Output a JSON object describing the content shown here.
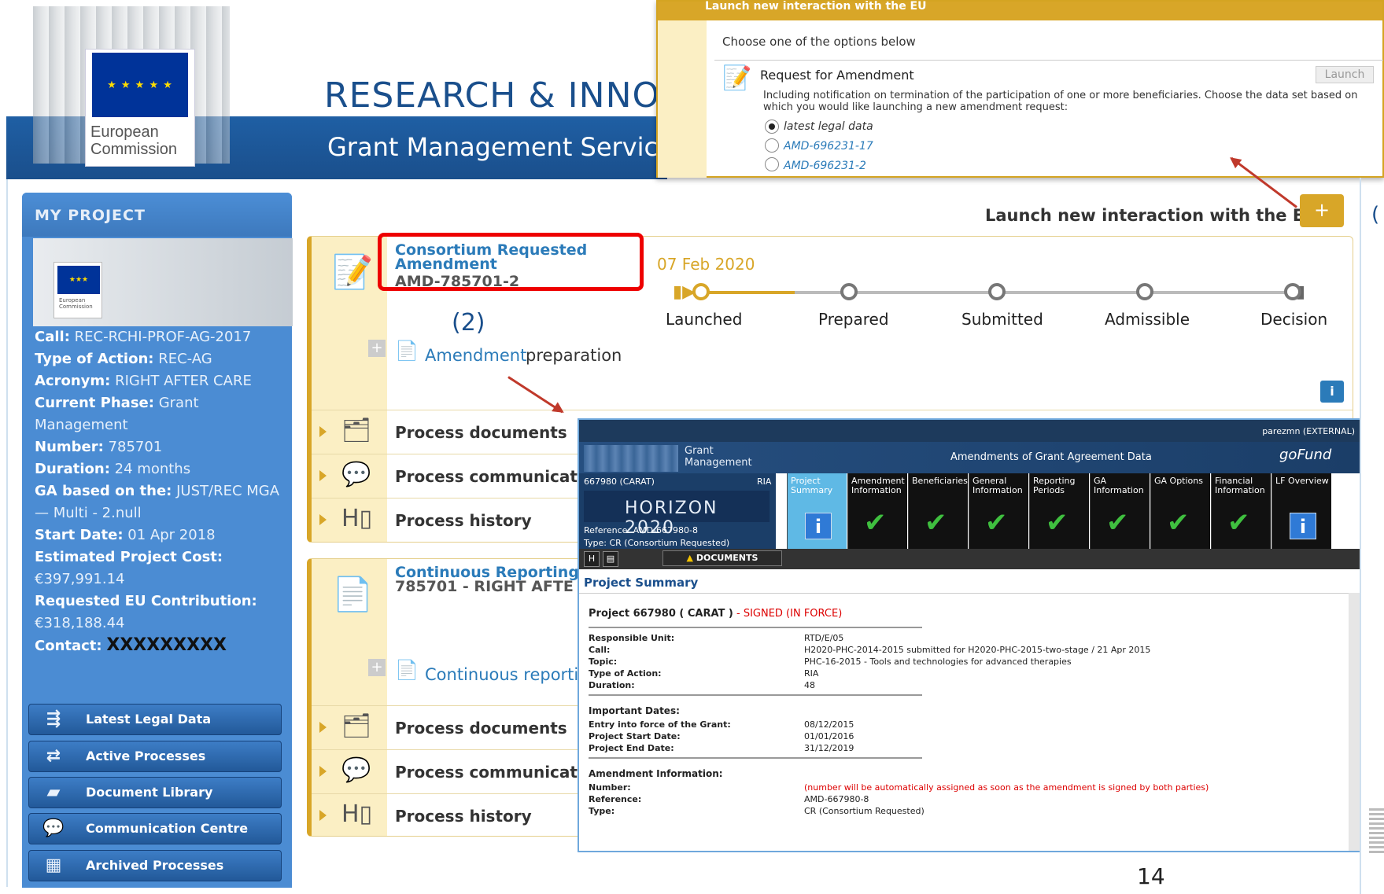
{
  "header": {
    "logo_stars": "★ ★ ★ ★ ★",
    "logo_name": "European Commission",
    "title_line1": "RESEARCH & INNOV",
    "title_line2": "Grant Management Service"
  },
  "popup": {
    "bar_title": "Launch new interaction with the EU",
    "hint": "Choose one of the options below",
    "option_title": "Request for Amendment",
    "launch_label": "Launch",
    "description": "Including notification on termination of the participation of one or more beneficiaries. Choose the data set based on which you would like launching a new amendment request:",
    "radios": [
      {
        "label": "latest legal data",
        "checked": true
      },
      {
        "label": "AMD-696231-17",
        "checked": false
      },
      {
        "label": "AMD-696231-2",
        "checked": false
      }
    ]
  },
  "sidebar": {
    "title": "MY PROJECT",
    "mini_logo": "European Commission",
    "info": [
      {
        "k": "Call:",
        "v": "REC-RCHI-PROF-AG-2017"
      },
      {
        "k": "Type of Action:",
        "v": "REC-AG"
      },
      {
        "k": "Acronym:",
        "v": "RIGHT AFTER CARE"
      },
      {
        "k": "Current Phase:",
        "v": "Grant Management"
      },
      {
        "k": "Number:",
        "v": "785701"
      },
      {
        "k": "Duration:",
        "v": "24 months"
      },
      {
        "k": "GA based on the:",
        "v": "JUST/REC MGA — Multi - 2.null"
      },
      {
        "k": "Start Date:",
        "v": "01 Apr 2018"
      },
      {
        "k": "Estimated Project Cost:",
        "v": "€397,991.14"
      },
      {
        "k": "Requested EU Contribution:",
        "v": "€318,188.44"
      },
      {
        "k": "Contact:",
        "v": "XXXXXXXXX"
      }
    ],
    "buttons": [
      {
        "label": "Latest Legal Data",
        "icon": "data-icon"
      },
      {
        "label": "Active Processes",
        "icon": "arrows-icon"
      },
      {
        "label": "Document Library",
        "icon": "folder-icon"
      },
      {
        "label": "Communication Centre",
        "icon": "chat-icon"
      },
      {
        "label": "Archived Processes",
        "icon": "archive-icon"
      }
    ]
  },
  "main": {
    "launch_label": "Launch new interaction with the EU",
    "launch_plus": "+",
    "paren_right": "(",
    "annotation_2": "(2)",
    "card1": {
      "title_line1": "Consortium Requested",
      "title_line2": "Amendment",
      "ref": "AMD-785701-2",
      "date": "07 Feb 2020",
      "steps": [
        "Launched",
        "Prepared",
        "Submitted",
        "Admissible",
        "Decision"
      ],
      "current_step": 0,
      "task_link": "Amendment",
      "task_rest": " preparation",
      "rows": [
        "Process documents",
        "Process communication",
        "Process history"
      ]
    },
    "card2": {
      "title": "Continuous Reporting",
      "ref": "785701 - RIGHT AFTE",
      "task_link": "Continuous reporti",
      "rows": [
        "Process documents",
        "Process communication",
        "Process history"
      ]
    },
    "page_number": "14"
  },
  "inner": {
    "user": "parezmn (EXTERNAL)",
    "brand": "Grant Management",
    "heading": "Amendments of Grant Agreement Data",
    "logo": "goFund",
    "project_id": "667980 (CARAT)",
    "ria": "RIA",
    "programme": "HORIZON 2020",
    "reference": "Reference: AMD-667980-8",
    "type": "Type: CR (Consortium Requested)",
    "tabs": [
      {
        "label": "Project Summary",
        "mark": "info"
      },
      {
        "label": "Amendment Information",
        "mark": "check"
      },
      {
        "label": "Beneficiaries",
        "mark": "check"
      },
      {
        "label": "General Information",
        "mark": "check"
      },
      {
        "label": "Reporting Periods",
        "mark": "check"
      },
      {
        "label": "GA Information",
        "mark": "check"
      },
      {
        "label": "GA Options",
        "mark": "check"
      },
      {
        "label": "Financial Information",
        "mark": "check"
      },
      {
        "label": "LF Overview",
        "mark": "info"
      }
    ],
    "documents_btn": "DOCUMENTS",
    "section_title": "Project Summary",
    "project_line": "Project 667980 ( CARAT )",
    "project_status": " - SIGNED (IN FORCE)",
    "rows1": [
      {
        "k": "Responsible Unit:",
        "v": "RTD/E/05"
      },
      {
        "k": "Call:",
        "v": "H2020-PHC-2014-2015 submitted for H2020-PHC-2015-two-stage / 21 Apr 2015"
      },
      {
        "k": "Topic:",
        "v": "PHC-16-2015 - Tools and technologies for advanced therapies"
      },
      {
        "k": "Type of Action:",
        "v": "RIA"
      },
      {
        "k": "Duration:",
        "v": "48"
      }
    ],
    "section2": "Important Dates:",
    "rows2": [
      {
        "k": "Entry into force of the Grant:",
        "v": "08/12/2015"
      },
      {
        "k": "Project Start Date:",
        "v": "01/01/2016"
      },
      {
        "k": "Project End Date:",
        "v": "31/12/2019"
      }
    ],
    "section3": "Amendment Information:",
    "rows3": [
      {
        "k": "Number:",
        "v": "(number will be automatically assigned as soon as the amendment is signed by both parties)"
      },
      {
        "k": "Reference:",
        "v": "AMD-667980-8"
      },
      {
        "k": "Type:",
        "v": "CR (Consortium Requested)"
      }
    ]
  }
}
